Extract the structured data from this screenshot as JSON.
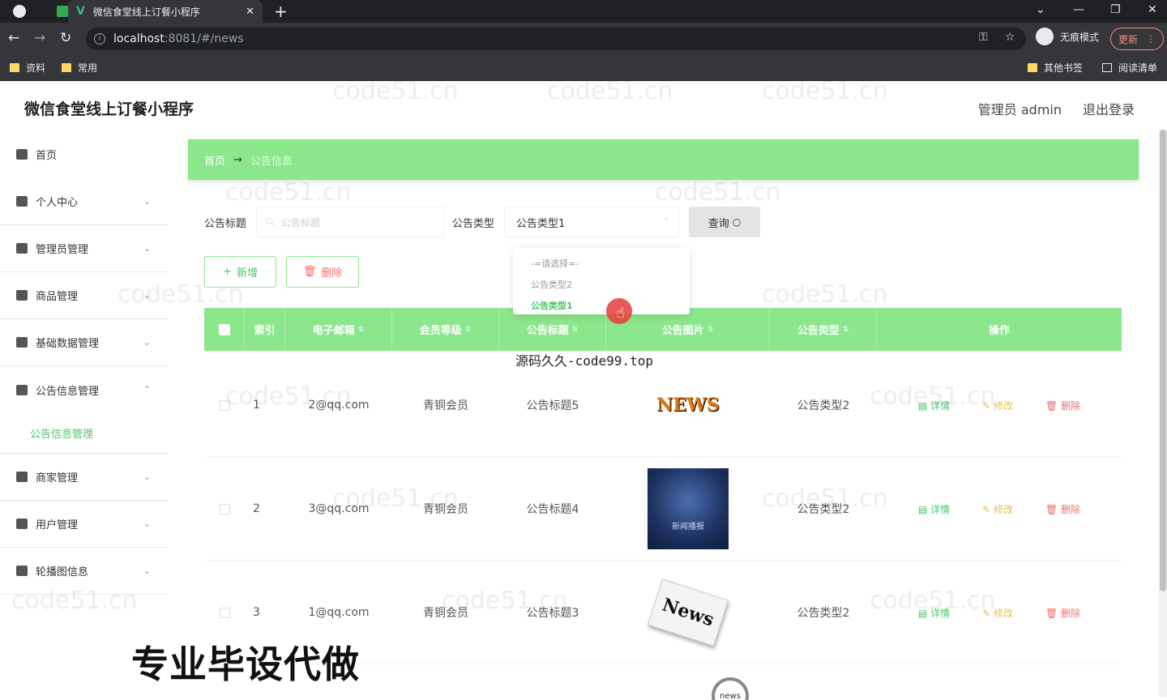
{
  "browser": {
    "tab_title": "微信食堂线上订餐小程序",
    "url_host": "localhost",
    "url_rest": ":8081/#/news",
    "incognito_label": "无痕模式",
    "update_label": "更新",
    "bookmarks": [
      "资料",
      "常用"
    ],
    "bookmarks_right": [
      "其他书签",
      "阅读清单"
    ]
  },
  "header": {
    "title": "微信食堂线上订餐小程序",
    "user": "管理员 admin",
    "logout": "退出登录"
  },
  "sidebar": {
    "items": [
      {
        "label": "首页"
      },
      {
        "label": "个人中心"
      },
      {
        "label": "管理员管理"
      },
      {
        "label": "商品管理"
      },
      {
        "label": "基础数据管理"
      },
      {
        "label": "公告信息管理"
      },
      {
        "label": "商家管理"
      },
      {
        "label": "用户管理"
      },
      {
        "label": "轮播图信息"
      }
    ],
    "sub_item": "公告信息管理"
  },
  "breadcrumb": {
    "home": "首页",
    "current": "公告信息"
  },
  "search": {
    "title_label": "公告标题",
    "title_placeholder": "公告标题",
    "type_label": "公告类型",
    "type_value": "公告类型1",
    "query_label": "查询"
  },
  "dropdown": {
    "options": [
      "-=请选择=-",
      "公告类型2",
      "公告类型1"
    ]
  },
  "actions": {
    "add": "新增",
    "delete": "删除"
  },
  "table": {
    "headers": [
      "索引",
      "电子邮箱",
      "会员等级",
      "公告标题",
      "公告图片",
      "公告类型",
      "操作"
    ],
    "rows": [
      {
        "index": "1",
        "email": "2@qq.com",
        "level": "青铜会员",
        "title": "公告标题5",
        "type": "公告类型2",
        "img_text": "NEWS"
      },
      {
        "index": "2",
        "email": "3@qq.com",
        "level": "青铜会员",
        "title": "公告标题4",
        "type": "公告类型2",
        "img_text": "新闻播报"
      },
      {
        "index": "3",
        "email": "1@qq.com",
        "level": "青铜会员",
        "title": "公告标题3",
        "type": "公告类型2",
        "img_text": "News"
      }
    ],
    "row4_img_text": "news",
    "op_detail": "详情",
    "op_edit": "修改",
    "op_delete": "删除"
  },
  "overlays": {
    "watermark": "code51.cn",
    "source": "源码久久-code99.top",
    "banner": "专业毕设代做"
  }
}
